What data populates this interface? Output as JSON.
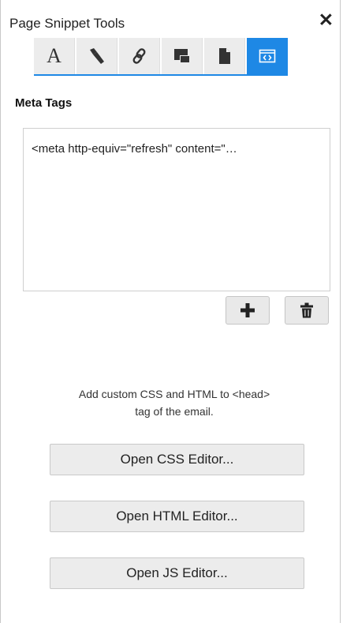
{
  "panel": {
    "title": "Page Snippet Tools",
    "close_label": "✕"
  },
  "toolbar": {
    "items": [
      {
        "name": "text-format",
        "icon": "letter-a-icon",
        "label": "A"
      },
      {
        "name": "brush",
        "icon": "paint-brush-icon"
      },
      {
        "name": "link",
        "icon": "link-icon"
      },
      {
        "name": "image",
        "icon": "image-icon"
      },
      {
        "name": "document",
        "icon": "document-icon"
      },
      {
        "name": "code",
        "icon": "code-icon",
        "active": true
      }
    ],
    "active_color": "#1e88e5"
  },
  "meta_tags": {
    "heading": "Meta Tags",
    "items": [
      "<meta http-equiv=\"refresh\" content=\"…"
    ]
  },
  "help_text": {
    "line1": "Add custom CSS and HTML to <head>",
    "line2": "tag of the email."
  },
  "buttons": {
    "css": "Open CSS Editor...",
    "html": "Open HTML Editor...",
    "js": "Open JS Editor..."
  }
}
